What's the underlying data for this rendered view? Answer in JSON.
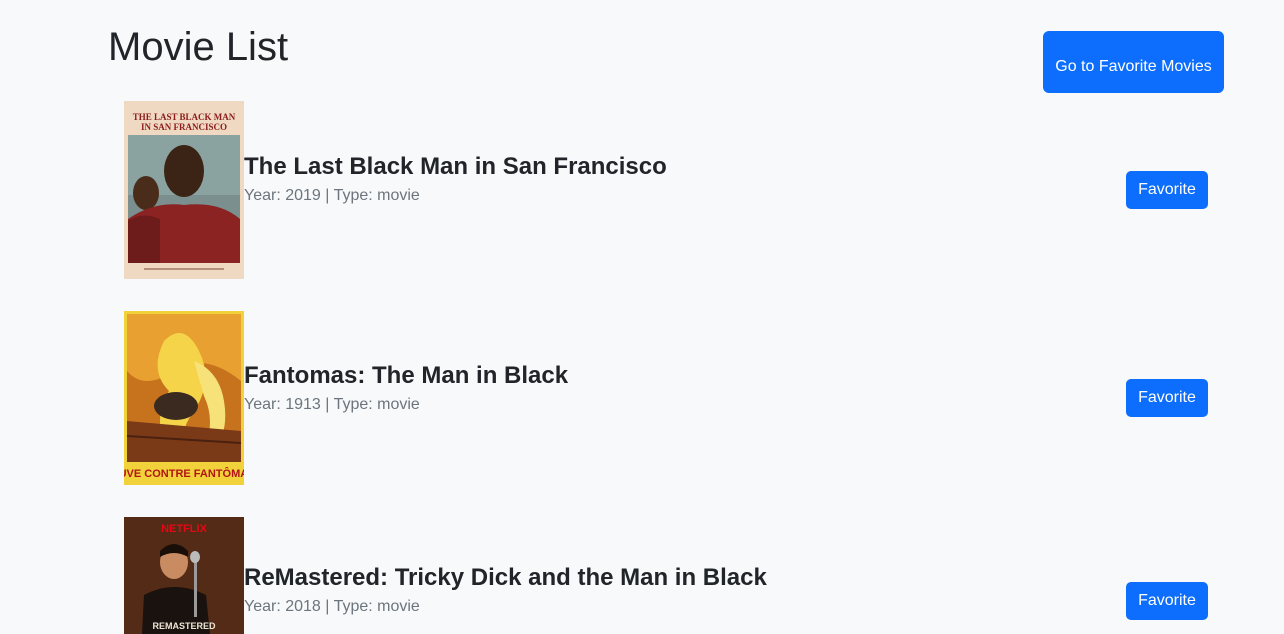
{
  "header": {
    "title": "Movie List",
    "favorites_button_label": "Go to Favorite Movies"
  },
  "movies": [
    {
      "title": "The Last Black Man in San Francisco",
      "meta": "Year: 2019 | Type: movie",
      "favorite_label": "Favorite",
      "poster_text": [
        "THE LAST BLACK MAN",
        "IN SAN FRANCISCO"
      ]
    },
    {
      "title": "Fantomas: The Man in Black",
      "meta": "Year: 1913 | Type: movie",
      "favorite_label": "Favorite",
      "poster_text": [
        "JUVE CONTRE FANTÔMAS"
      ]
    },
    {
      "title": "ReMastered: Tricky Dick and the Man in Black",
      "meta": "Year: 2018 | Type: movie",
      "favorite_label": "Favorite",
      "poster_text": [
        "NETFLIX",
        "REMASTERED"
      ]
    }
  ],
  "colors": {
    "background": "#f8f9fa",
    "primary": "#0d6efd",
    "muted_text": "#6c757d",
    "heading_text": "#212529"
  }
}
